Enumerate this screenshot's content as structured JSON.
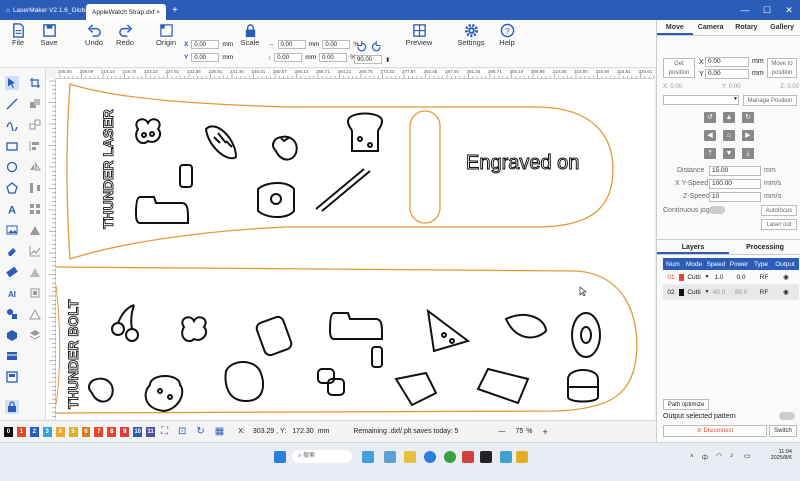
{
  "window": {
    "app_title": "LaserMaker V2.1.6_Global",
    "doc_tab": "AppleWatch Strap.dxf",
    "new_tab": "+",
    "minimize": "—",
    "maximize": "☐",
    "close": "✕"
  },
  "toolbar": {
    "file": "File",
    "save": "Save",
    "undo": "Undo",
    "redo": "Redo",
    "origin": "Origin",
    "scale": "Scale",
    "preview": "Preview",
    "settings": "Settings",
    "help": "Help",
    "x_label": "X",
    "y_label": "Y",
    "x_value": "0.00",
    "y_value": "0.00",
    "w_value": "0.00",
    "h_value": "0.00",
    "unit_mm": "mm",
    "unit_pct": "%",
    "rotate_value": "90.00"
  },
  "ruler": {
    "top_ticks": [
      "205.00",
      "209.09",
      "214.14",
      "219.70",
      "223.22",
      "227.81",
      "232.36",
      "236.91",
      "241.46",
      "246.01",
      "250.57",
      "255.12",
      "259.71",
      "264.21",
      "268.75",
      "273.33",
      "277.87",
      "282.45",
      "287.00",
      "291.25",
      "295.71",
      "300.16",
      "305.95",
      "310.00",
      "315.00",
      "319.90",
      "324.81",
      "329.61"
    ]
  },
  "canvas": {
    "strap1_vertical_text": "THUNDER LASER",
    "strap1_label": "Engraved on",
    "strap2_vertical_text": "THUNDER BOLT"
  },
  "bottom": {
    "layer_chips": [
      "0",
      "1",
      "2",
      "3",
      "4",
      "5",
      "6",
      "7",
      "8",
      "9",
      "10",
      "11"
    ],
    "x_label": "X:",
    "x_value": "303.29",
    "y_label": ", Y:",
    "y_value": "172.30",
    "unit": "mm",
    "status": "Remaining .dxf/.plt saves today: 5",
    "zoom": "75",
    "zoom_unit": "%",
    "zoom_minus": "—",
    "zoom_plus": "+"
  },
  "right_panel": {
    "tabs": [
      "Move",
      "Camera",
      "Rotary",
      "Gallery"
    ],
    "get_position": "Get position",
    "x_label": "X",
    "y_label": "Y",
    "x_value": "0.00",
    "y_value": "0.00",
    "unit": "mm",
    "move_to_position": "Move to position",
    "x_read": "X: 0.00",
    "y_read": "Y: 0.00",
    "z_read": "Z: 0.00",
    "manage_position": "Manage Position",
    "distance_label": "Distance",
    "distance_value": "15.00",
    "distance_unit": "mm",
    "xy_speed_label": "X Y-Speed",
    "xy_speed_value": "100.00",
    "speed_unit": "mm/s",
    "z_speed_label": "Z-Speed",
    "z_speed_value": "10",
    "continuous_jog": "Continuous jog",
    "autofocus": "Autofocus",
    "laser_out": "Laser out",
    "layers_tab": "Layers",
    "processing_tab": "Processing",
    "table_headers": [
      "Num",
      "Mode",
      "Speed",
      "Power",
      "Type",
      "Output"
    ],
    "rows": [
      {
        "num": "01",
        "mode": "Cutti",
        "speed": "1.0",
        "power": "0.0",
        "type": "RF",
        "color": "#e6472b"
      },
      {
        "num": "02",
        "mode": "Cutti",
        "speed": "40.0",
        "power": "99.0",
        "type": "RF",
        "color": "#111111"
      }
    ],
    "path_optimize": "Path optimize",
    "output_selected": "Output selected pattern",
    "disconnect": "Disconnect",
    "switch": "Switch"
  },
  "taskbar": {
    "search_placeholder": "搜索",
    "time": "11:04",
    "date": "2025/8/6",
    "lang": "中"
  },
  "colors": {
    "accent": "#2b5db8",
    "strap_outline": "#e29a3a",
    "chip_colors": [
      "#111111",
      "#e6472b",
      "#2b5db8",
      "#3aa0d8",
      "#f0a830",
      "#e0b020",
      "#d08020",
      "#e6472b",
      "#e6472b",
      "#d84040",
      "#2b5db8",
      "#5050a0"
    ]
  }
}
